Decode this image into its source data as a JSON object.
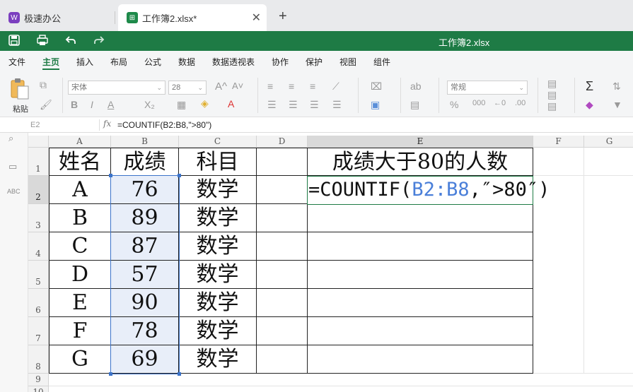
{
  "tabs": {
    "app_tab_label": "极速办公",
    "app_logo_glyph": "W",
    "doc_tab_label": "工作簿2.xlsx*",
    "doc_logo_glyph": "⊞",
    "close_glyph": "✕",
    "new_tab_glyph": "+"
  },
  "titlebar": {
    "title": "工作簿2.xlsx",
    "accent_color": "#1e7b45"
  },
  "menu": {
    "items": [
      "文件",
      "主页",
      "插入",
      "布局",
      "公式",
      "数据",
      "数据透视表",
      "协作",
      "保护",
      "视图",
      "组件"
    ],
    "active_index": 1
  },
  "ribbon": {
    "paste_label": "粘贴",
    "font_name": "宋体",
    "font_size": "28",
    "number_format": "常规"
  },
  "formula_bar": {
    "name_box": "E2",
    "fx_label": "fx",
    "formula": "=COUNTIF(B2:B8,\">80\")"
  },
  "sheet": {
    "columns": [
      "A",
      "B",
      "C",
      "D",
      "E",
      "F",
      "G"
    ],
    "rows": [
      "1",
      "2",
      "3",
      "4",
      "5",
      "6",
      "7",
      "8",
      "9",
      "10"
    ],
    "header": [
      "姓名",
      "成绩",
      "科目"
    ],
    "e1_title": "成绩大于80的人数",
    "data": [
      [
        "A",
        "76",
        "数学"
      ],
      [
        "B",
        "89",
        "数学"
      ],
      [
        "C",
        "87",
        "数学"
      ],
      [
        "D",
        "57",
        "数学"
      ],
      [
        "E",
        "90",
        "数学"
      ],
      [
        "F",
        "78",
        "数学"
      ],
      [
        "G",
        "69",
        "数学"
      ]
    ],
    "editing": {
      "prefix": "=COUNTIF(",
      "ref": "B2:B8",
      "suffix": ",″>80″)"
    },
    "selection_color": "#3b73c9"
  }
}
